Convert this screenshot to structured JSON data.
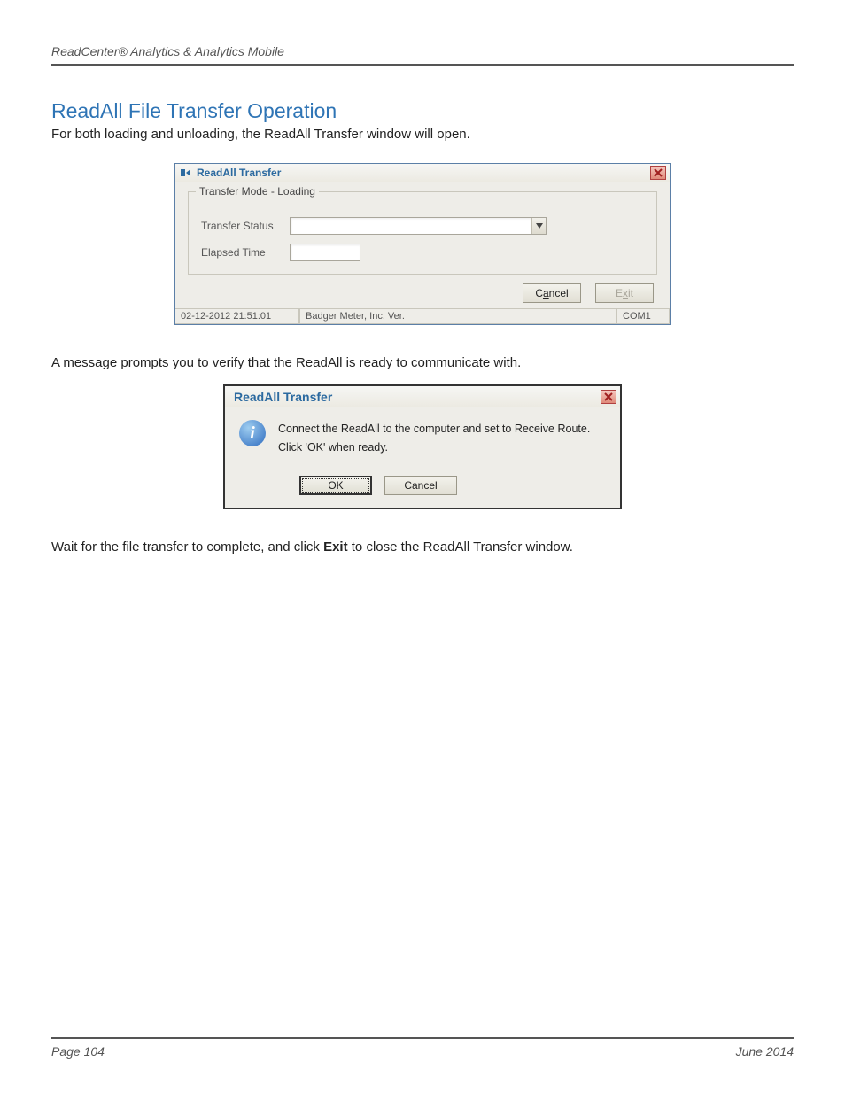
{
  "header": {
    "product": "ReadCenter® Analytics & Analytics Mobile"
  },
  "section": {
    "title": "ReadAll File Transfer Operation",
    "intro": "For both loading and unloading, the ReadAll Transfer window will open."
  },
  "window1": {
    "title": "ReadAll Transfer",
    "group_legend": "Transfer Mode - Loading",
    "status_label": "Transfer Status",
    "elapsed_label": "Elapsed Time",
    "cancel_label": "Cancel",
    "cancel_hotkey_char": "a",
    "exit_label": "Exit",
    "exit_hotkey_char": "x",
    "status_cells": {
      "timestamp": "02-12-2012  21:51:01",
      "company": "Badger Meter, Inc. Ver.",
      "port": "COM1"
    }
  },
  "paragraph2": "A message prompts you to verify that the ReadAll is ready to communicate with.",
  "dialog": {
    "title": "ReadAll Transfer",
    "line1": "Connect the ReadAll to the computer and set to Receive Route.",
    "line2": "Click 'OK' when ready.",
    "ok": "OK",
    "cancel": "Cancel"
  },
  "paragraph3_pre": "Wait for the file transfer to complete, and click ",
  "paragraph3_bold": "Exit",
  "paragraph3_post": " to close the ReadAll Transfer window.",
  "footer": {
    "page": "Page 104",
    "date": "June 2014"
  }
}
